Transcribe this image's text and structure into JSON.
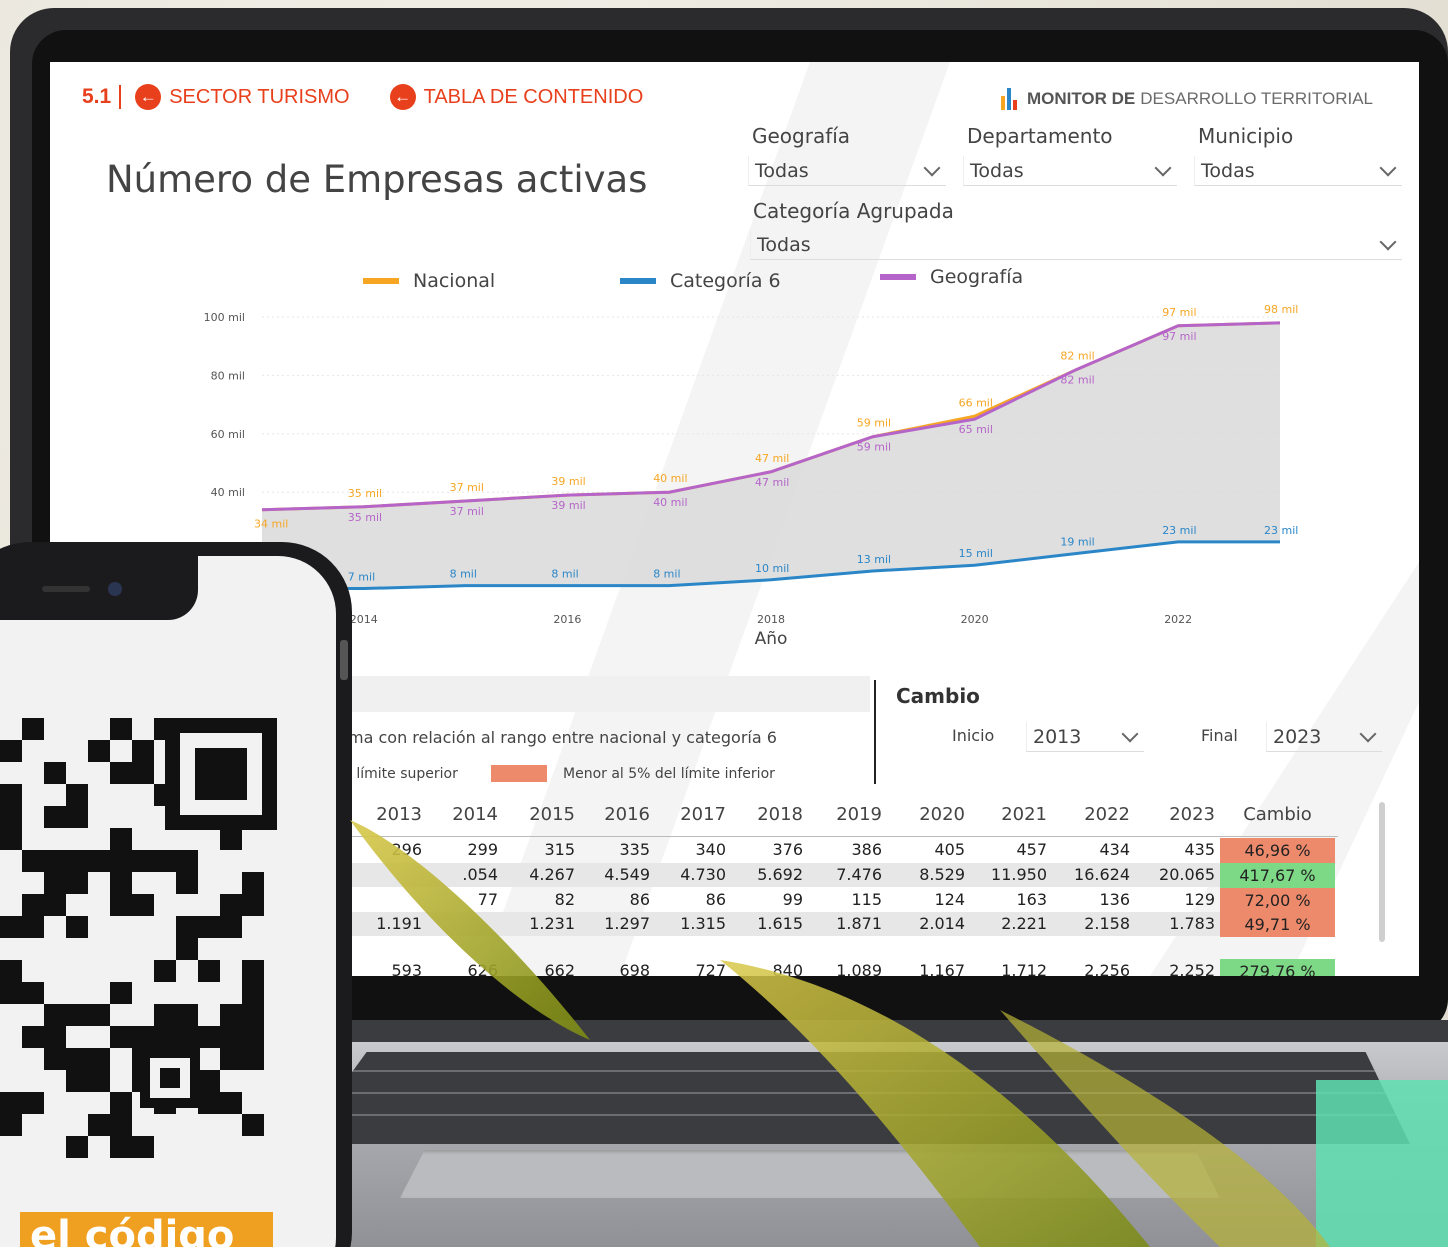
{
  "header": {
    "section_number": "5.1",
    "back_icon": "arrow-left-circle-icon",
    "nav": [
      "SECTOR TURISMO",
      "TABLA DE CONTENIDO"
    ],
    "brand_bold": "MONITOR DE",
    "brand_light": "DESARROLLO TERRITORIAL"
  },
  "page_title": "Número de Empresas activas",
  "filters": {
    "geografia": {
      "label": "Geografía",
      "value": "Todas"
    },
    "departamento": {
      "label": "Departamento",
      "value": "Todas"
    },
    "municipio": {
      "label": "Municipio",
      "value": "Todas"
    },
    "categoria": {
      "label": "Categoría Agrupada",
      "value": "Todas"
    }
  },
  "colors": {
    "accent": "#e8401c",
    "nacional": "#f6a623",
    "categoria": "#2b86c8",
    "geografia": "#b565c9",
    "band": "#d9d9d9",
    "red_cell": "#ee8a6c",
    "green_cell": "#7ed987"
  },
  "chart_data": {
    "type": "line",
    "legend": [
      "Nacional",
      "Categoría 6",
      "Geografía"
    ],
    "x": [
      2013,
      2014,
      2015,
      2016,
      2017,
      2018,
      2019,
      2020,
      2021,
      2022,
      2023
    ],
    "x_ticks": [
      "2014",
      "2016",
      "2018",
      "2020",
      "2022"
    ],
    "xlabel": "Año",
    "y_ticks": [
      "40 mil",
      "60 mil",
      "80 mil",
      "100 mil"
    ],
    "ylim": [
      0,
      100
    ],
    "series": [
      {
        "name": "Nacional",
        "values": [
          34,
          35,
          37,
          39,
          40,
          47,
          59,
          66,
          82,
          97,
          98
        ],
        "labels": [
          "34 mil",
          "35 mil",
          "37 mil",
          "39 mil",
          "40 mil",
          "47 mil",
          "59 mil",
          "66 mil",
          "82 mil",
          "97 mil",
          "98 mil"
        ]
      },
      {
        "name": "Geografía",
        "values": [
          34,
          35,
          37,
          39,
          40,
          47,
          59,
          65,
          82,
          97,
          98
        ],
        "labels": [
          "35 mil",
          "37 mil",
          "39 mil",
          "40 mil",
          "47 mil",
          "59 mil",
          "65 mil",
          "82 mil",
          "97 mil"
        ]
      },
      {
        "name": "Categoría 6",
        "values": [
          7,
          7,
          8,
          8,
          8,
          10,
          13,
          15,
          19,
          23,
          23
        ],
        "labels": [
          "7 mil",
          "8 mil",
          "8 mil",
          "8 mil",
          "10 mil",
          "13 mil",
          "15 mil",
          "19 mil",
          "23 mil",
          "23 mil"
        ]
      }
    ]
  },
  "note": {
    "line1": "ma con relación al rango entre nacional y categoría 6",
    "upper": "l límite superior",
    "lower": "Menor al 5% del límite inferior"
  },
  "cambio": {
    "title": "Cambio",
    "inicio_label": "Inicio",
    "inicio_value": "2013",
    "final_label": "Final",
    "final_value": "2023"
  },
  "table": {
    "headers": [
      "2013",
      "2014",
      "2015",
      "2016",
      "2017",
      "2018",
      "2019",
      "2020",
      "2021",
      "2022",
      "2023",
      "Cambio"
    ],
    "rows": [
      {
        "cells": [
          "296",
          "299",
          "315",
          "335",
          "340",
          "376",
          "386",
          "405",
          "457",
          "434",
          "435"
        ],
        "change": "46,96 %",
        "status": "red"
      },
      {
        "cells": [
          "",
          ".054",
          "4.267",
          "4.549",
          "4.730",
          "5.692",
          "7.476",
          "8.529",
          "11.950",
          "16.624",
          "20.065"
        ],
        "change": "417,67 %",
        "status": "green"
      },
      {
        "cells": [
          "",
          "77",
          "82",
          "86",
          "86",
          "99",
          "115",
          "124",
          "163",
          "136",
          "129"
        ],
        "change": "72,00 %",
        "status": "red"
      },
      {
        "cells": [
          "1.191",
          "",
          "1.231",
          "1.297",
          "1.315",
          "1.615",
          "1.871",
          "2.014",
          "2.221",
          "2.158",
          "1.783"
        ],
        "change": "49,71 %",
        "status": "red"
      },
      {
        "cells": [
          "593",
          "626",
          "662",
          "698",
          "727",
          "840",
          "1.089",
          "1.167",
          "1.712",
          "2.256",
          "2.252"
        ],
        "change": "279,76 %",
        "status": "green"
      }
    ]
  },
  "phone": {
    "tag_text": "el código"
  }
}
